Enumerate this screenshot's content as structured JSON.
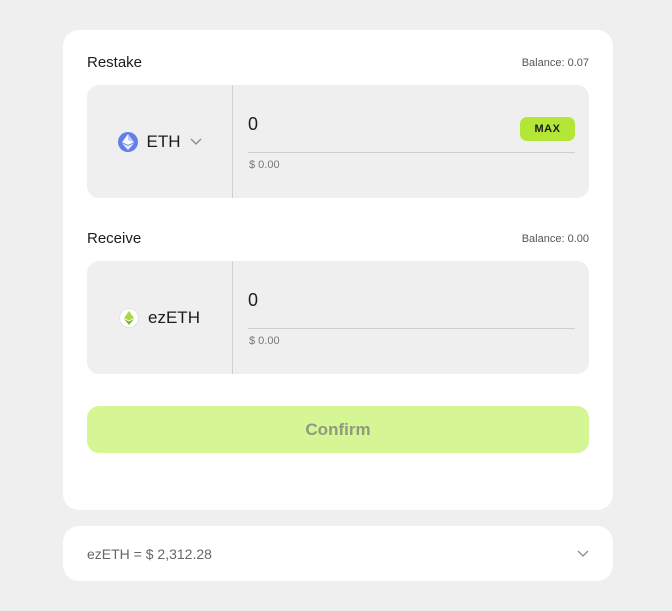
{
  "restake": {
    "title": "Restake",
    "balance": "Balance: 0.07",
    "token": {
      "name": "ETH",
      "icon": "eth-icon"
    },
    "amount": "0",
    "usd": "$ 0.00",
    "max_label": "MAX"
  },
  "receive": {
    "title": "Receive",
    "balance": "Balance: 0.00",
    "token": {
      "name": "ezETH",
      "icon": "ezeth-icon"
    },
    "amount": "0",
    "usd": "$ 0.00"
  },
  "confirm_label": "Confirm",
  "rate": {
    "text": "ezETH = $ 2,312.28"
  },
  "colors": {
    "accent": "#b3e635",
    "confirm_disabled": "#d6f595",
    "eth_blue": "#627eea",
    "panel_bg": "#efefef"
  }
}
